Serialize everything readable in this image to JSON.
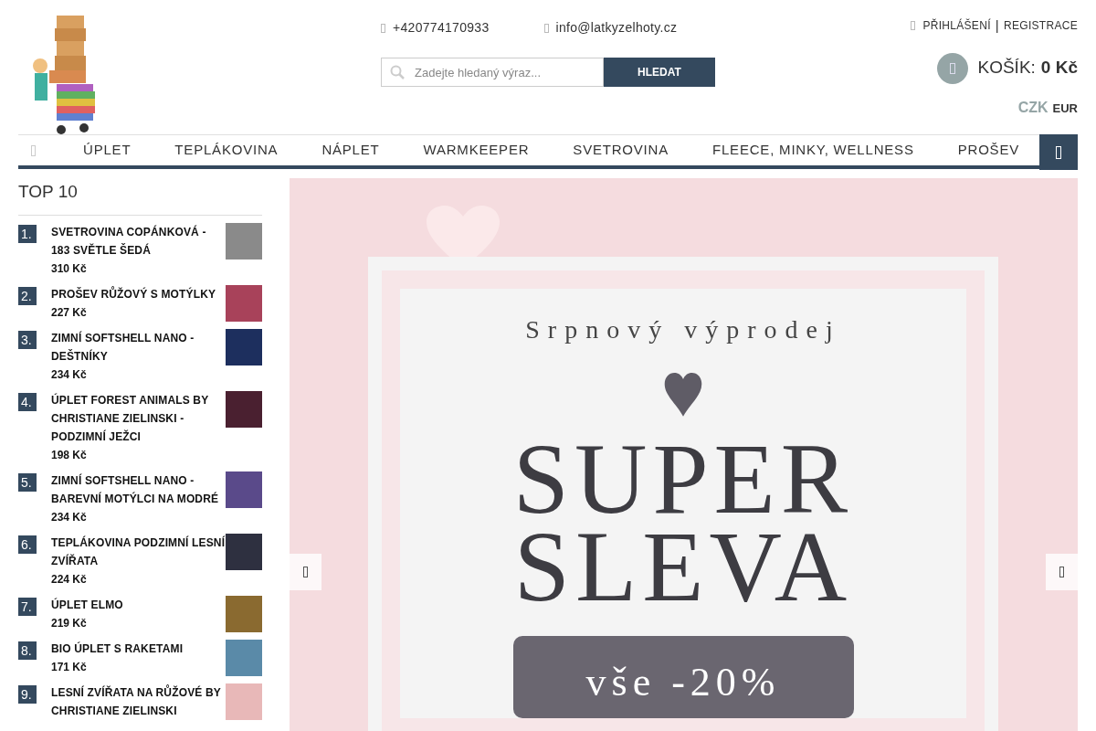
{
  "header": {
    "phone": "+420774170933",
    "email": "info@latkyzelhoty.cz",
    "login": "PŘIHLÁŠENÍ",
    "separator": "|",
    "register": "REGISTRACE",
    "search": {
      "placeholder": "Zadejte hledaný výraz...",
      "button": "HLEDAT"
    },
    "cart": {
      "label": "KOŠÍK:",
      "amount": "0 Kč"
    },
    "currencies": [
      {
        "label": "CZK",
        "selected": true
      },
      {
        "label": "EUR",
        "selected": false
      }
    ]
  },
  "nav": {
    "items": [
      "ÚPLET",
      "TEPLÁKOVINA",
      "NÁPLET",
      "WARMKEEPER",
      "SVETROVINA",
      "FLEECE, MINKY, WELLNESS",
      "PROŠEV"
    ]
  },
  "top10": {
    "title": "TOP 10",
    "items": [
      {
        "rank": "1.",
        "name": "SVETROVINA COPÁNKOVÁ - 183 SVĚTLE ŠEDÁ",
        "price": "310 Kč",
        "color": "#8a8a8a"
      },
      {
        "rank": "2.",
        "name": "PROŠEV RŮŽOVÝ S MOTÝLKY",
        "price": "227 Kč",
        "color": "#a8425a"
      },
      {
        "rank": "3.",
        "name": "ZIMNÍ SOFTSHELL NANO - DEŠTNÍKY",
        "price": "234 Kč",
        "color": "#1d2f5e"
      },
      {
        "rank": "4.",
        "name": "ÚPLET FOREST ANIMALS BY CHRISTIANE ZIELINSKI - PODZIMNÍ JEŽCI",
        "price": "198 Kč",
        "color": "#4a2030"
      },
      {
        "rank": "5.",
        "name": "ZIMNÍ SOFTSHELL NANO - BAREVNÍ MOTÝLCI NA MODRÉ",
        "price": "234 Kč",
        "color": "#5a4a8a"
      },
      {
        "rank": "6.",
        "name": "TEPLÁKOVINA PODZIMNÍ LESNÍ ZVÍŘATA",
        "price": "224 Kč",
        "color": "#2e3040"
      },
      {
        "rank": "7.",
        "name": "ÚPLET ELMO",
        "price": "219 Kč",
        "color": "#8a6a30"
      },
      {
        "rank": "8.",
        "name": "BIO ÚPLET S RAKETAMI",
        "price": "171 Kč",
        "color": "#5a8aa8"
      },
      {
        "rank": "9.",
        "name": "LESNÍ ZVÍŘATA NA RŮŽOVÉ BY CHRISTIANE ZIELINSKI",
        "color": "#e8b8b8"
      }
    ]
  },
  "banner": {
    "subtitle": "Srpnový výprodej",
    "title_lines": [
      "SUPER",
      "SLEVA"
    ],
    "badge": "vše -20%"
  }
}
